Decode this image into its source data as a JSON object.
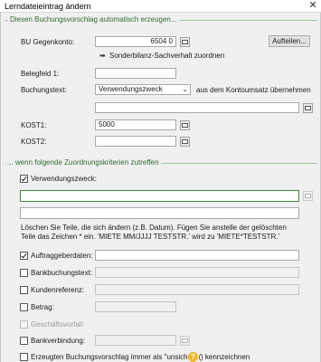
{
  "window": {
    "title": "Lerndateieintrag ändern",
    "close_glyph": "✕"
  },
  "section1": {
    "label": "Diesen Buchungsvorschlag automatisch erzeugen..."
  },
  "bu_gegenkonto": {
    "label": "BU Gegenkonto:",
    "value": "6504 0",
    "aufteilen_label": "Aufteilen...",
    "sonderbilanz_label": "Sonderbilanz-Sachverhalt zuordnen",
    "sonderbilanz_icon": "arrow-right-icon"
  },
  "belegfeld1": {
    "label": "Belegfeld 1:",
    "value": ""
  },
  "buchungstext": {
    "label": "Buchungstext:",
    "selected": "Verwendungszweck",
    "suffix": "aus dem Kontoumsatz übernehmen",
    "extra_value": ""
  },
  "kost1": {
    "label": "KOST1:",
    "value": "5000"
  },
  "kost2": {
    "label": "KOST2:",
    "value": ""
  },
  "section2": {
    "label": "... wenn folgende Zuordnungskriterien zutreffen"
  },
  "verwendungszweck": {
    "label": "Verwendungszweck:",
    "checked": true,
    "value1": "",
    "value2": "",
    "note_line1": "Löschen Sie Teile, die sich ändern (z.B. Datum). Fügen Sie anstelle der gelöschten",
    "note_line2": "Teile das Zeichen * ein. 'MIETE MM/JJJJ TESTSTR.' wird zu 'MIETE*TESTSTR.'"
  },
  "criteria": [
    {
      "label": "Auftraggeberdaten:",
      "checked": true,
      "value": "",
      "enabled": true
    },
    {
      "label": "Bankbuchungstext:",
      "checked": false,
      "value": "",
      "enabled": true
    },
    {
      "label": "Kundenreferenz:",
      "checked": false,
      "value": "",
      "enabled": true
    },
    {
      "label": "Betrag:",
      "checked": false,
      "value": "",
      "enabled": true
    },
    {
      "label": "Geschäftsvorfall:",
      "checked": false,
      "value": "",
      "enabled": false
    },
    {
      "label": "Bankverbindung:",
      "checked": false,
      "value": "",
      "enabled": true
    }
  ],
  "unsicher": {
    "label_before": "Erzeugten Buchungsvorschlag immer als \"unsicher\" (",
    "label_after": ") kennzeichnen",
    "help_glyph": "?",
    "checked": false
  }
}
